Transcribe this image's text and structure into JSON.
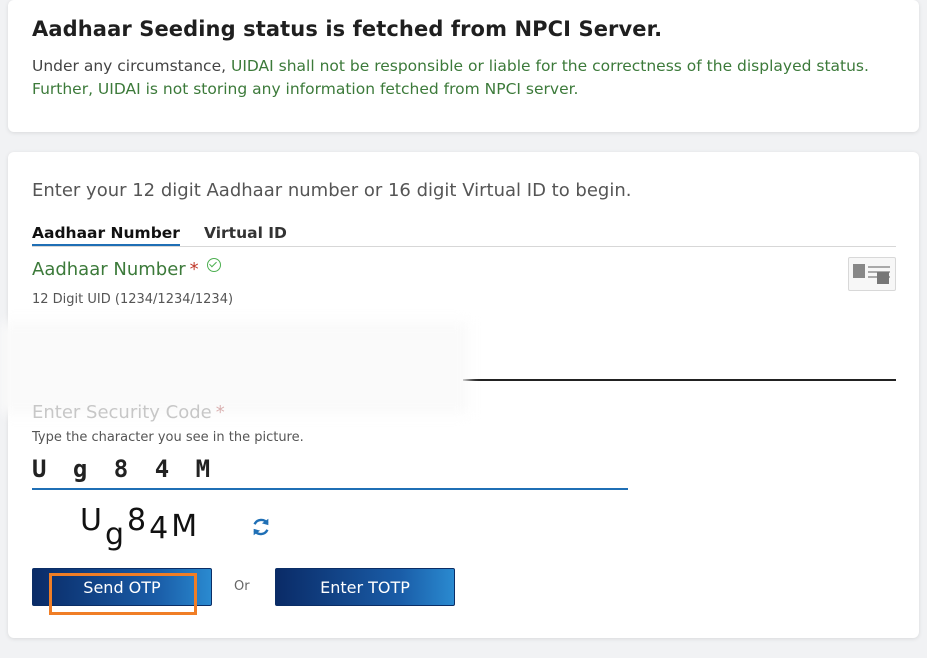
{
  "notice": {
    "title": "Aadhaar Seeding status is fetched from NPCI Server.",
    "text_lead": "Under any circumstance, ",
    "text_rest": "UIDAI shall not be responsible or liable for the correctness of the displayed status. Further, UIDAI is not storing any information fetched from NPCI server."
  },
  "form": {
    "intro": "Enter your 12 digit Aadhaar number or 16 digit Virtual ID to begin.",
    "tabs": [
      {
        "label": "Aadhaar Number",
        "active": true
      },
      {
        "label": "Virtual ID",
        "active": false
      }
    ],
    "aadhaar_field": {
      "label": "Aadhaar Number",
      "required_mark": "*",
      "hint": "12 Digit UID (1234/1234/1234)"
    },
    "security": {
      "label": "Enter Security Code",
      "required_mark": "*",
      "hint": "Type the character you see in the picture.",
      "value": "U g 8 4 M",
      "captcha": [
        "U",
        "g",
        "8",
        "4",
        "M"
      ]
    },
    "buttons": {
      "send_otp": "Send OTP",
      "or": "Or",
      "enter_totp": "Enter TOTP"
    }
  },
  "colors": {
    "accent_green": "#3c7a3a",
    "button_blue": "#0a2b67",
    "highlight_orange": "#f07e26"
  },
  "icons": [
    "check-circle-icon",
    "aadhaar-card-icon",
    "refresh-icon"
  ]
}
